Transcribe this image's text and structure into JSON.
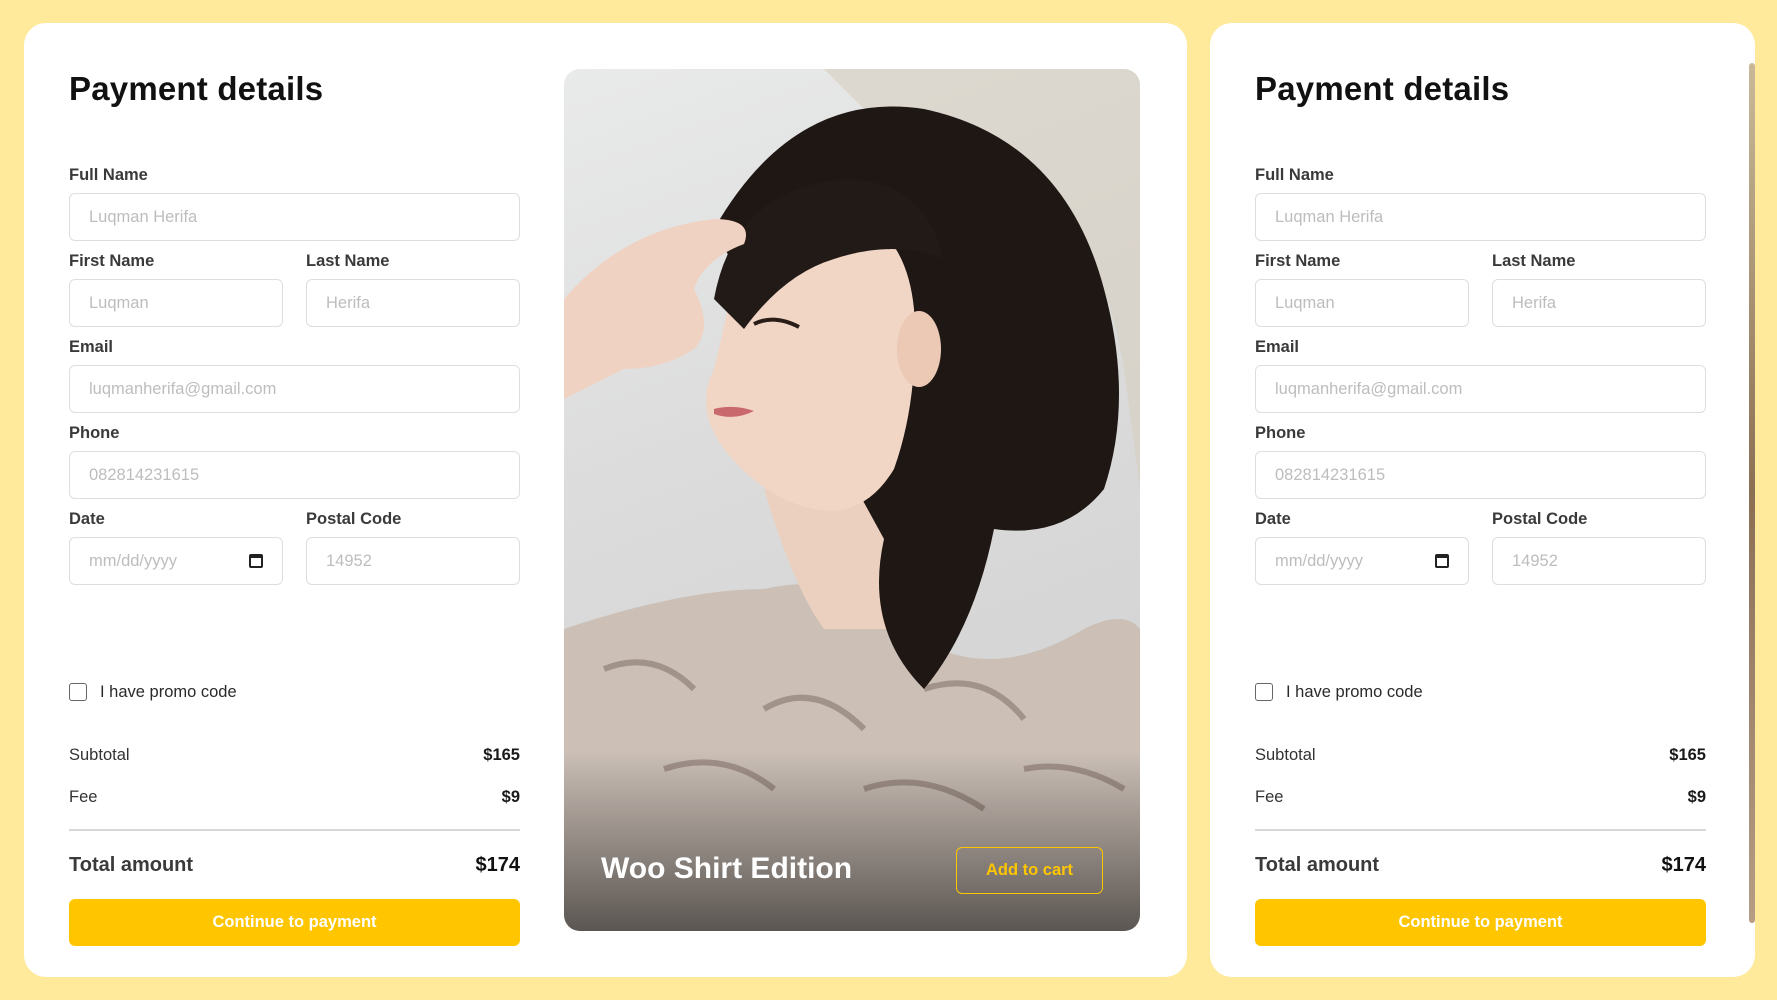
{
  "colors": {
    "background": "#ffe99b",
    "accent": "#ffc600",
    "card": "#ffffff"
  },
  "form": {
    "title": "Payment details",
    "full_name": {
      "label": "Full Name",
      "placeholder": "Luqman Herifa"
    },
    "first_name": {
      "label": "First Name",
      "placeholder": "Luqman"
    },
    "last_name": {
      "label": "Last Name",
      "placeholder": "Herifa"
    },
    "email": {
      "label": "Email",
      "placeholder": "luqmanherifa@gmail.com"
    },
    "phone": {
      "label": "Phone",
      "placeholder": "082814231615"
    },
    "date": {
      "label": "Date",
      "placeholder": "mm/dd/yyyy",
      "icon": "calendar-icon"
    },
    "postal_code": {
      "label": "Postal Code",
      "placeholder": "14952"
    },
    "promo_label": "I have promo code",
    "subtotal": {
      "label": "Subtotal",
      "value": "$165"
    },
    "fee": {
      "label": "Fee",
      "value": "$9"
    },
    "total": {
      "label": "Total amount",
      "value": "$174"
    },
    "continue_label": "Continue to payment"
  },
  "product": {
    "name": "Woo Shirt Edition",
    "add_to_cart_label": "Add to cart"
  }
}
